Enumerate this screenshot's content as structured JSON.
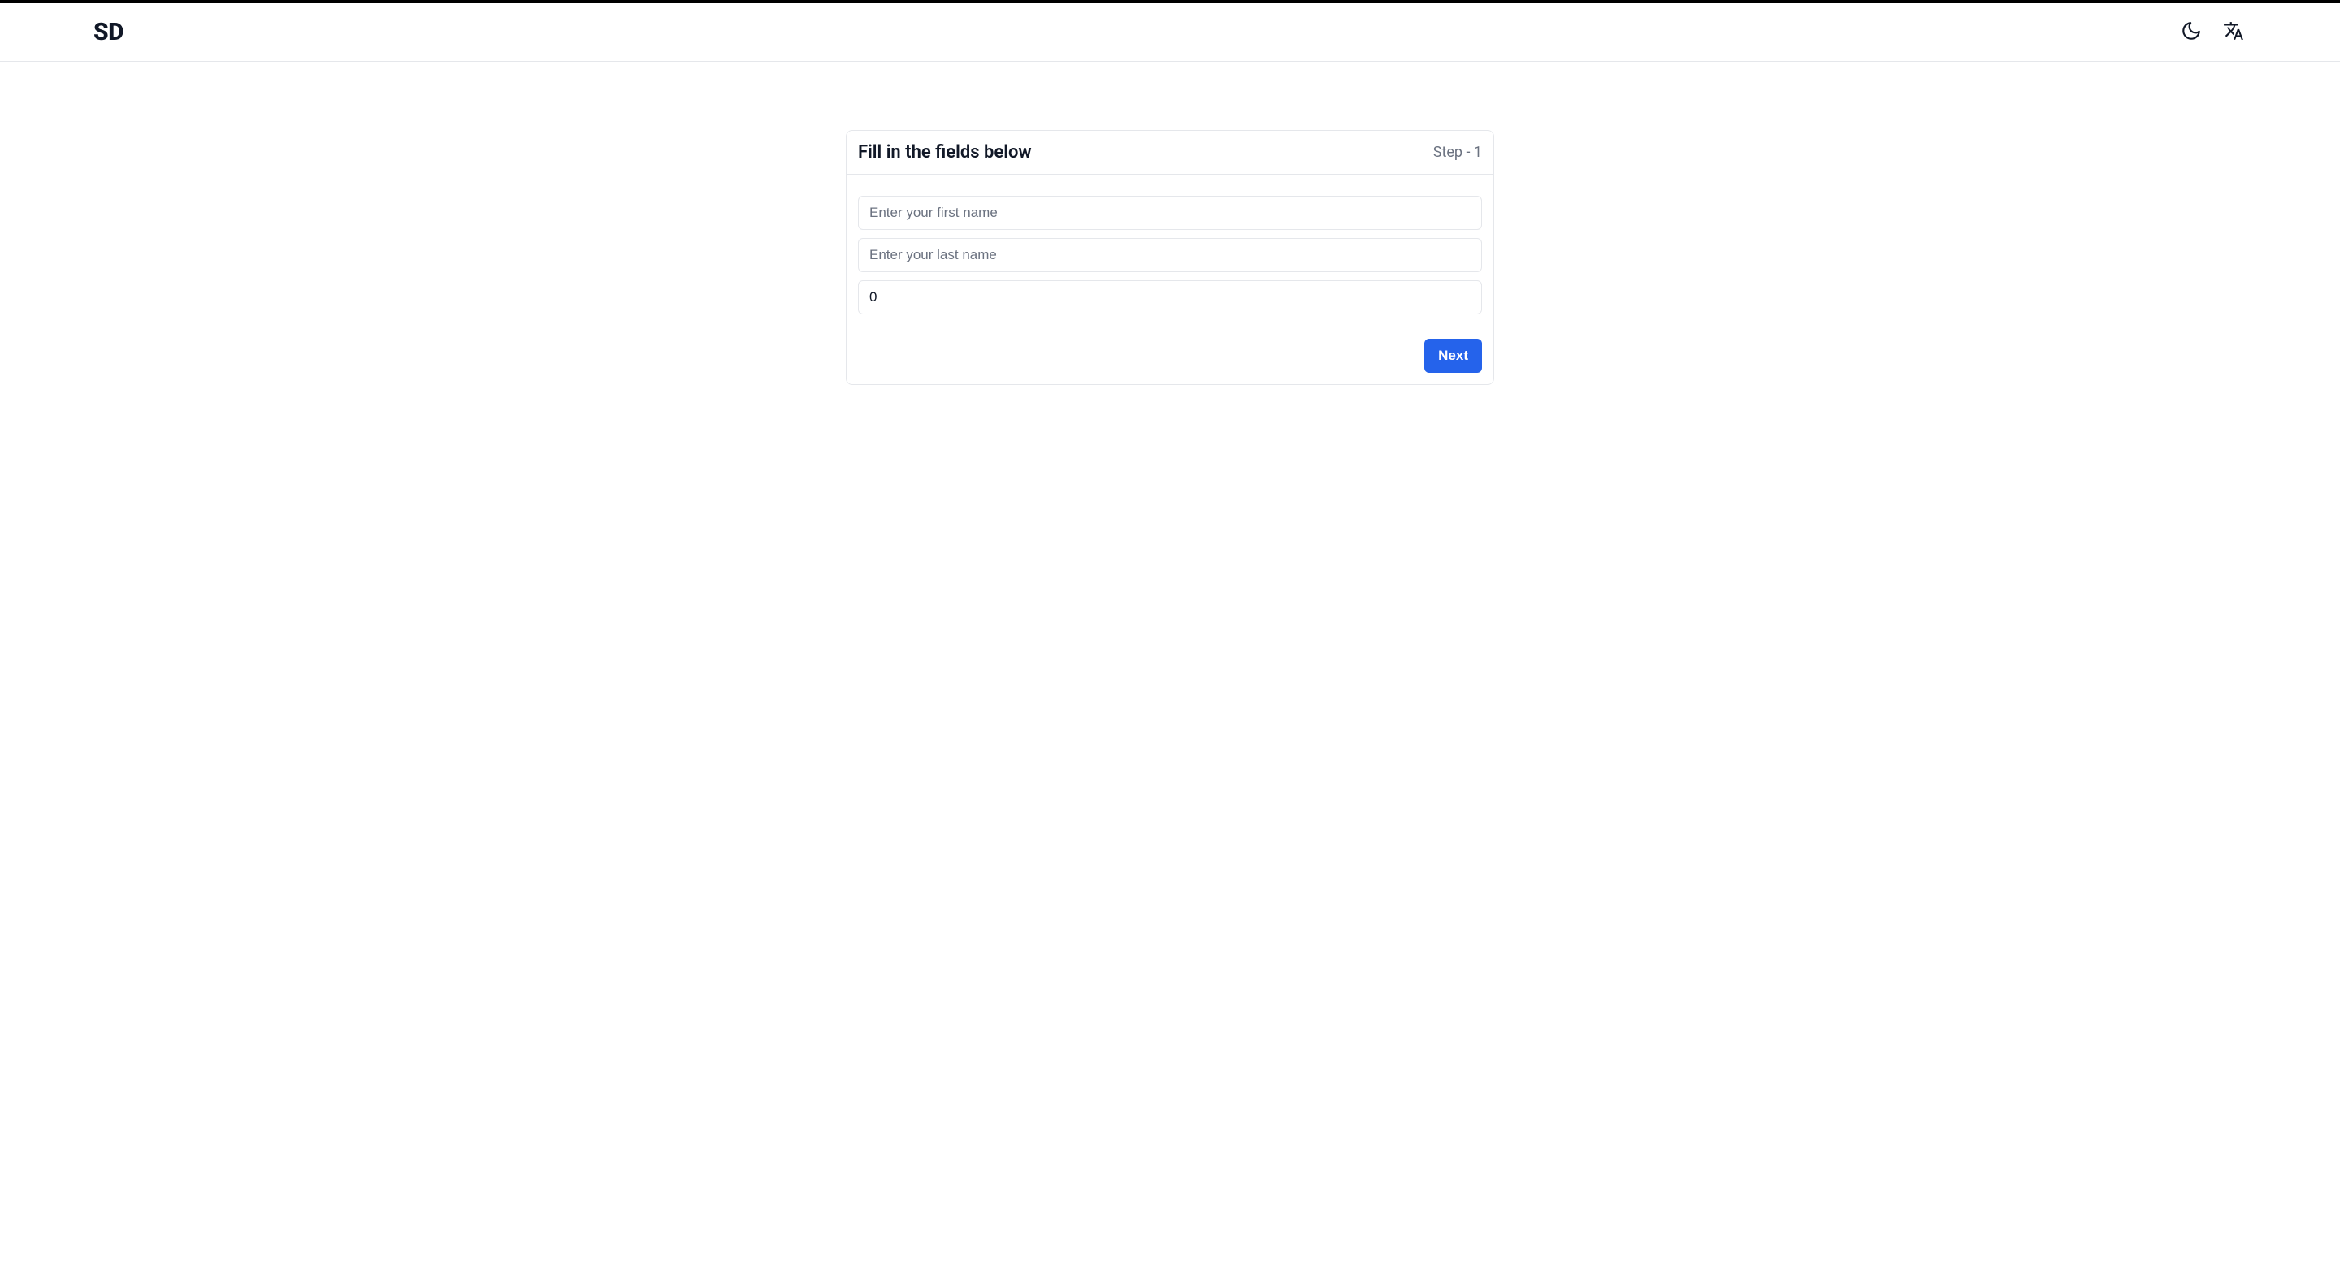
{
  "header": {
    "logo": "SD"
  },
  "card": {
    "title": "Fill in the fields below",
    "step_label": "Step - 1"
  },
  "form": {
    "first_name": {
      "placeholder": "Enter your first name",
      "value": ""
    },
    "last_name": {
      "placeholder": "Enter your last name",
      "value": ""
    },
    "number": {
      "value": "0"
    }
  },
  "actions": {
    "next_label": "Next"
  }
}
